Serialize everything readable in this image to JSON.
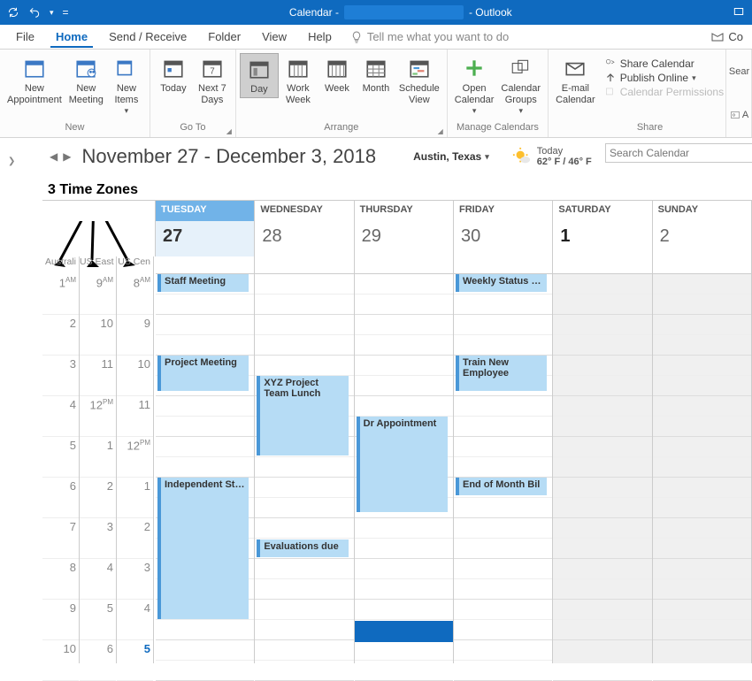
{
  "titlebar": {
    "prefix": "Calendar - ",
    "suffix": " - Outlook"
  },
  "tabs": {
    "file": "File",
    "home": "Home",
    "sendreceive": "Send / Receive",
    "folder": "Folder",
    "view": "View",
    "help": "Help",
    "tellme": "Tell me what you want to do",
    "co": "Co"
  },
  "ribbon": {
    "new_appt": "New\nAppointment",
    "new_meeting": "New\nMeeting",
    "new_items": "New\nItems",
    "group_new": "New",
    "today": "Today",
    "next7": "Next 7\nDays",
    "group_goto": "Go To",
    "day": "Day",
    "workweek": "Work\nWeek",
    "week": "Week",
    "month": "Month",
    "schedule": "Schedule\nView",
    "group_arrange": "Arrange",
    "opencal": "Open\nCalendar",
    "calgroups": "Calendar\nGroups",
    "group_manage": "Manage Calendars",
    "emailcal": "E-mail\nCalendar",
    "sharecal": "Share Calendar",
    "publish": "Publish Online",
    "perms": "Calendar Permissions",
    "group_share": "Share",
    "sear": "Sear",
    "a_icon": "A"
  },
  "nav": {
    "daterange": "November 27 - December 3, 2018",
    "location": "Austin, Texas",
    "today_lbl": "Today",
    "temps": "62° F / 46° F",
    "search_ph": "Search Calendar"
  },
  "annotation": "3 Time Zones",
  "tz": {
    "c1": "Australi",
    "c2": "US East",
    "c3": "US Cen"
  },
  "days": {
    "tue": "TUESDAY",
    "wed": "WEDNESDAY",
    "thu": "THURSDAY",
    "fri": "FRIDAY",
    "sat": "SATURDAY",
    "sun": "SUNDAY"
  },
  "dates": {
    "d27": "27",
    "d28": "28",
    "d29": "29",
    "d30": "30",
    "d1": "1",
    "d2": "2"
  },
  "times_c1": [
    "1",
    "2",
    "3",
    "4",
    "5",
    "6",
    "7",
    "8",
    "9",
    "10"
  ],
  "times_ampm_c1": [
    "AM",
    "",
    "",
    "",
    "",
    "",
    "",
    "",
    "",
    ""
  ],
  "times_c2": [
    "9",
    "10",
    "11",
    "12",
    "1",
    "2",
    "3",
    "4",
    "5",
    "6"
  ],
  "times_ampm_c2": [
    "AM",
    "",
    "",
    "PM",
    "",
    "",
    "",
    "",
    "",
    ""
  ],
  "times_c3": [
    "8",
    "9",
    "10",
    "11",
    "12",
    "1",
    "2",
    "3",
    "4",
    "5"
  ],
  "times_ampm_c3": [
    "AM",
    "",
    "",
    "",
    "PM",
    "",
    "",
    "",
    "",
    ""
  ],
  "events": {
    "staff": "Staff Meeting",
    "project": "Project Meeting",
    "independent": "Independent Study",
    "xyz": "XYZ Project Team Lunch",
    "evals": "Evaluations due",
    "drappt": "Dr Appointment",
    "weekly": "Weekly Status Du",
    "train": "Train New Employee",
    "eom": "End of Month Bil"
  }
}
